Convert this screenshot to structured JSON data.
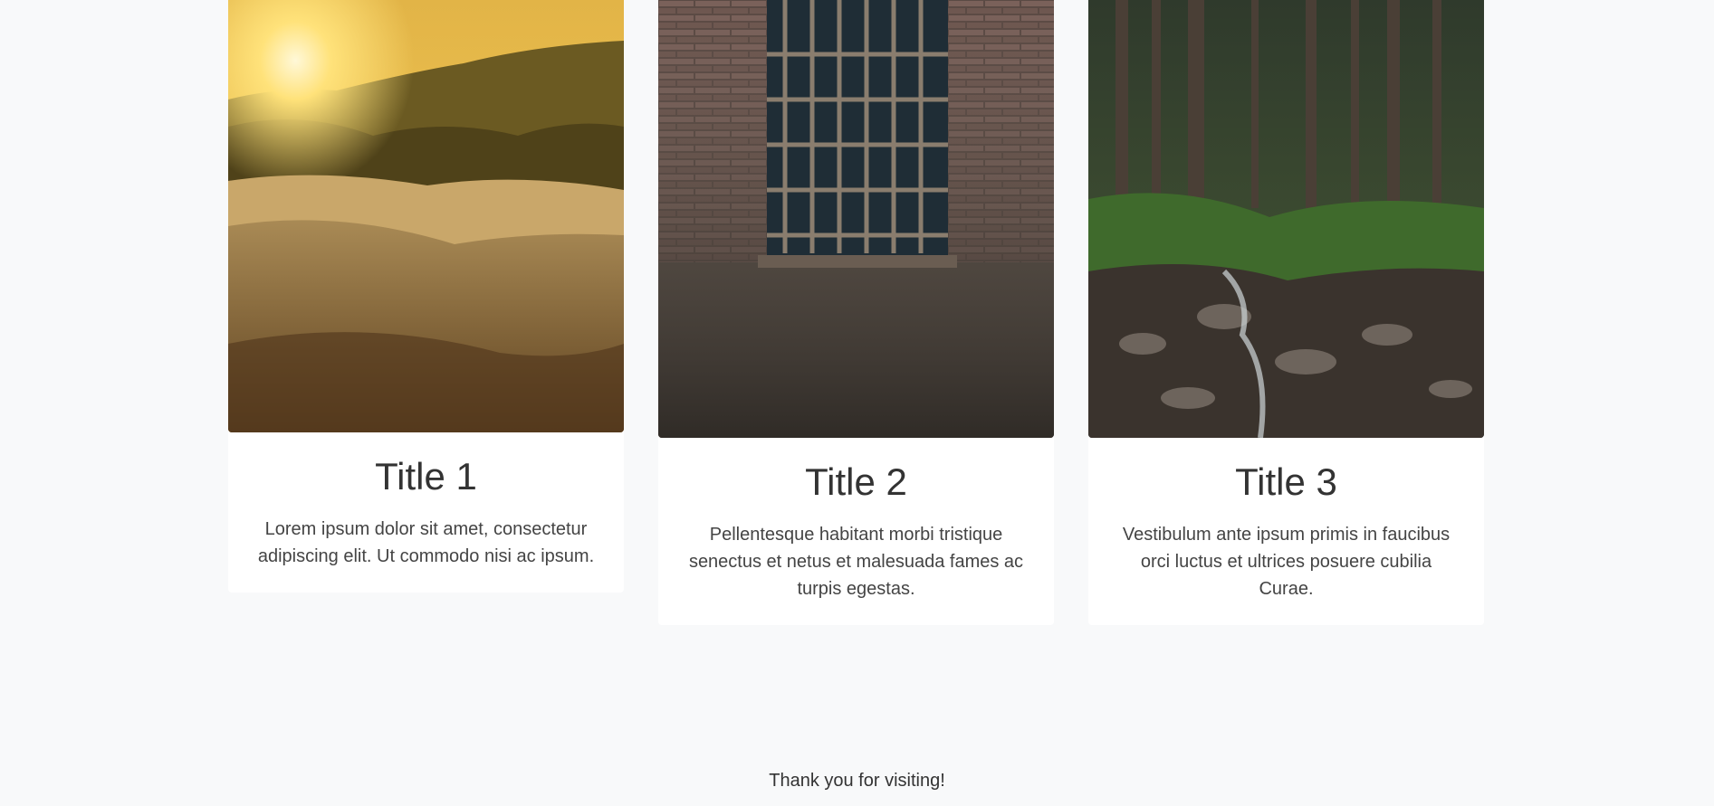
{
  "cards": [
    {
      "title": "Title 1",
      "text": "Lorem ipsum dolor sit amet, consectetur adipiscing elit. Ut commodo nisi ac ipsum.",
      "image": "sunset-river-rocks-photo"
    },
    {
      "title": "Title 2",
      "text": "Pellentesque habitant morbi tristique senectus et netus et malesuada fames ac turpis egestas.",
      "image": "barred-window-brick-wall-photo"
    },
    {
      "title": "Title 3",
      "text": "Vestibulum ante ipsum primis in faucibus orci luctus et ultrices posuere cubilia Curae.",
      "image": "forest-stream-photo"
    }
  ],
  "footer": {
    "text": "Thank you for visiting!"
  }
}
